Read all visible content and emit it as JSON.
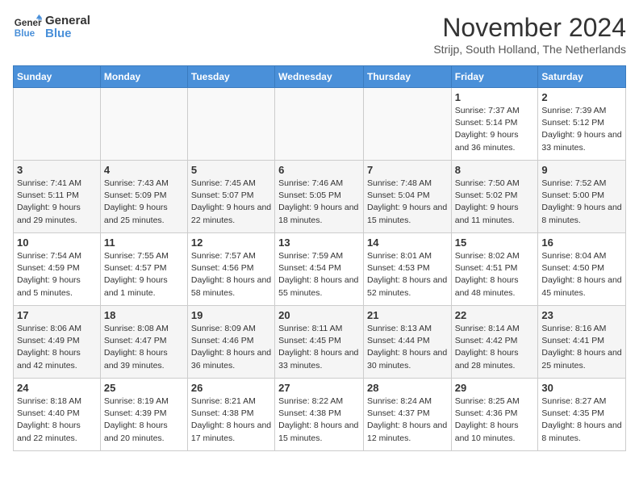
{
  "logo": {
    "line1": "General",
    "line2": "Blue"
  },
  "title": "November 2024",
  "subtitle": "Strijp, South Holland, The Netherlands",
  "weekdays": [
    "Sunday",
    "Monday",
    "Tuesday",
    "Wednesday",
    "Thursday",
    "Friday",
    "Saturday"
  ],
  "weeks": [
    [
      {
        "day": "",
        "info": ""
      },
      {
        "day": "",
        "info": ""
      },
      {
        "day": "",
        "info": ""
      },
      {
        "day": "",
        "info": ""
      },
      {
        "day": "",
        "info": ""
      },
      {
        "day": "1",
        "info": "Sunrise: 7:37 AM\nSunset: 5:14 PM\nDaylight: 9 hours and 36 minutes."
      },
      {
        "day": "2",
        "info": "Sunrise: 7:39 AM\nSunset: 5:12 PM\nDaylight: 9 hours and 33 minutes."
      }
    ],
    [
      {
        "day": "3",
        "info": "Sunrise: 7:41 AM\nSunset: 5:11 PM\nDaylight: 9 hours and 29 minutes."
      },
      {
        "day": "4",
        "info": "Sunrise: 7:43 AM\nSunset: 5:09 PM\nDaylight: 9 hours and 25 minutes."
      },
      {
        "day": "5",
        "info": "Sunrise: 7:45 AM\nSunset: 5:07 PM\nDaylight: 9 hours and 22 minutes."
      },
      {
        "day": "6",
        "info": "Sunrise: 7:46 AM\nSunset: 5:05 PM\nDaylight: 9 hours and 18 minutes."
      },
      {
        "day": "7",
        "info": "Sunrise: 7:48 AM\nSunset: 5:04 PM\nDaylight: 9 hours and 15 minutes."
      },
      {
        "day": "8",
        "info": "Sunrise: 7:50 AM\nSunset: 5:02 PM\nDaylight: 9 hours and 11 minutes."
      },
      {
        "day": "9",
        "info": "Sunrise: 7:52 AM\nSunset: 5:00 PM\nDaylight: 9 hours and 8 minutes."
      }
    ],
    [
      {
        "day": "10",
        "info": "Sunrise: 7:54 AM\nSunset: 4:59 PM\nDaylight: 9 hours and 5 minutes."
      },
      {
        "day": "11",
        "info": "Sunrise: 7:55 AM\nSunset: 4:57 PM\nDaylight: 9 hours and 1 minute."
      },
      {
        "day": "12",
        "info": "Sunrise: 7:57 AM\nSunset: 4:56 PM\nDaylight: 8 hours and 58 minutes."
      },
      {
        "day": "13",
        "info": "Sunrise: 7:59 AM\nSunset: 4:54 PM\nDaylight: 8 hours and 55 minutes."
      },
      {
        "day": "14",
        "info": "Sunrise: 8:01 AM\nSunset: 4:53 PM\nDaylight: 8 hours and 52 minutes."
      },
      {
        "day": "15",
        "info": "Sunrise: 8:02 AM\nSunset: 4:51 PM\nDaylight: 8 hours and 48 minutes."
      },
      {
        "day": "16",
        "info": "Sunrise: 8:04 AM\nSunset: 4:50 PM\nDaylight: 8 hours and 45 minutes."
      }
    ],
    [
      {
        "day": "17",
        "info": "Sunrise: 8:06 AM\nSunset: 4:49 PM\nDaylight: 8 hours and 42 minutes."
      },
      {
        "day": "18",
        "info": "Sunrise: 8:08 AM\nSunset: 4:47 PM\nDaylight: 8 hours and 39 minutes."
      },
      {
        "day": "19",
        "info": "Sunrise: 8:09 AM\nSunset: 4:46 PM\nDaylight: 8 hours and 36 minutes."
      },
      {
        "day": "20",
        "info": "Sunrise: 8:11 AM\nSunset: 4:45 PM\nDaylight: 8 hours and 33 minutes."
      },
      {
        "day": "21",
        "info": "Sunrise: 8:13 AM\nSunset: 4:44 PM\nDaylight: 8 hours and 30 minutes."
      },
      {
        "day": "22",
        "info": "Sunrise: 8:14 AM\nSunset: 4:42 PM\nDaylight: 8 hours and 28 minutes."
      },
      {
        "day": "23",
        "info": "Sunrise: 8:16 AM\nSunset: 4:41 PM\nDaylight: 8 hours and 25 minutes."
      }
    ],
    [
      {
        "day": "24",
        "info": "Sunrise: 8:18 AM\nSunset: 4:40 PM\nDaylight: 8 hours and 22 minutes."
      },
      {
        "day": "25",
        "info": "Sunrise: 8:19 AM\nSunset: 4:39 PM\nDaylight: 8 hours and 20 minutes."
      },
      {
        "day": "26",
        "info": "Sunrise: 8:21 AM\nSunset: 4:38 PM\nDaylight: 8 hours and 17 minutes."
      },
      {
        "day": "27",
        "info": "Sunrise: 8:22 AM\nSunset: 4:38 PM\nDaylight: 8 hours and 15 minutes."
      },
      {
        "day": "28",
        "info": "Sunrise: 8:24 AM\nSunset: 4:37 PM\nDaylight: 8 hours and 12 minutes."
      },
      {
        "day": "29",
        "info": "Sunrise: 8:25 AM\nSunset: 4:36 PM\nDaylight: 8 hours and 10 minutes."
      },
      {
        "day": "30",
        "info": "Sunrise: 8:27 AM\nSunset: 4:35 PM\nDaylight: 8 hours and 8 minutes."
      }
    ]
  ]
}
